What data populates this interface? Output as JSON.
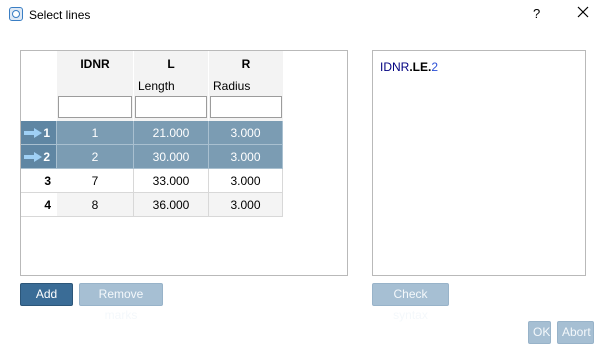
{
  "window": {
    "title": "Select lines",
    "help": "?"
  },
  "table": {
    "columns": [
      {
        "name": "IDNR",
        "sub": ""
      },
      {
        "name": "L",
        "sub": "Length"
      },
      {
        "name": "R",
        "sub": "Radius"
      }
    ],
    "filters": [
      "",
      "",
      ""
    ],
    "rows": [
      {
        "num": "1",
        "idnr": "1",
        "l": "21.000",
        "r": "3.000",
        "selected": true
      },
      {
        "num": "2",
        "idnr": "2",
        "l": "30.000",
        "r": "3.000",
        "selected": true
      },
      {
        "num": "3",
        "idnr": "7",
        "l": "33.000",
        "r": "3.000",
        "selected": false
      },
      {
        "num": "4",
        "idnr": "8",
        "l": "36.000",
        "r": "3.000",
        "selected": false
      }
    ]
  },
  "syntax": {
    "part1": "IDNR",
    "part2": ".LE.",
    "part3": "2"
  },
  "buttons": {
    "add_row": "Add row",
    "remove_marks": "Remove marks",
    "check_syntax": "Check syntax",
    "ok": "OK",
    "abort": "Abort"
  },
  "icons": {
    "app": "app-icon",
    "close": "close-icon",
    "row_arrow": "arrow-right-icon"
  },
  "colors": {
    "selected_row": "#7b9cb3",
    "primary_button": "#3a6c96",
    "disabled_button": "#a6bfd3"
  }
}
